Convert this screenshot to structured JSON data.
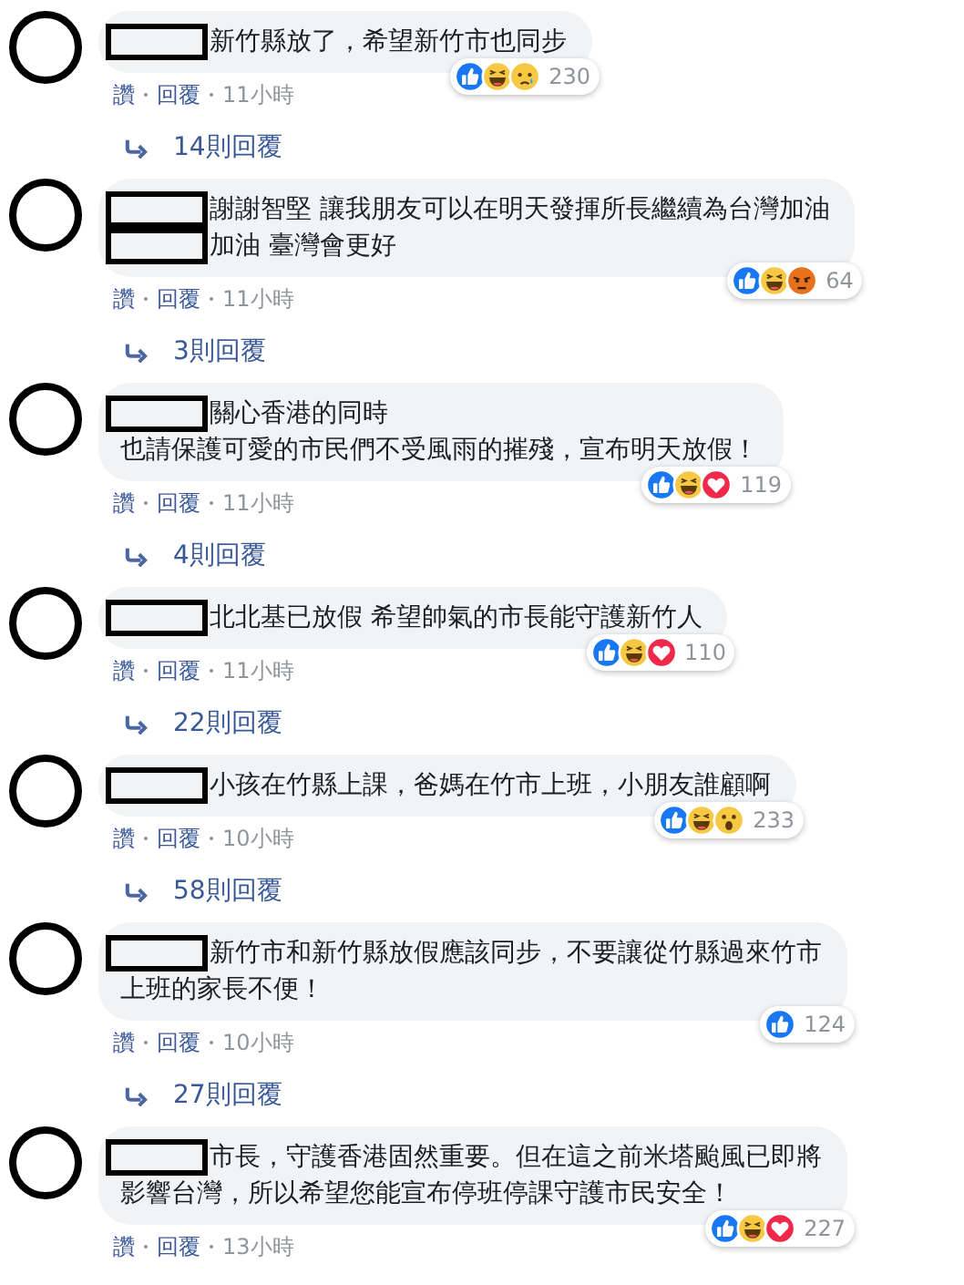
{
  "comments": [
    {
      "lines": [
        {
          "redacted": true,
          "text": "新竹縣放了，希望新竹市也同步"
        }
      ],
      "reactions": [
        {
          "kind": "like"
        },
        {
          "kind": "haha"
        },
        {
          "kind": "sad"
        }
      ],
      "reaction_count": "230",
      "like_label": "讚",
      "reply_label": "回覆",
      "time": "11小時",
      "replies": "14則回覆"
    },
    {
      "lines": [
        {
          "redacted": true,
          "text": "謝謝智堅 讓我朋友可以在明天發揮所長繼續為台灣加油"
        },
        {
          "redacted": true,
          "text": "加油 臺灣會更好"
        }
      ],
      "reactions": [
        {
          "kind": "like"
        },
        {
          "kind": "haha"
        },
        {
          "kind": "angry"
        }
      ],
      "reaction_count": "64",
      "like_label": "讚",
      "reply_label": "回覆",
      "time": "11小時",
      "replies": "3則回覆"
    },
    {
      "lines": [
        {
          "redacted": true,
          "text": "關心香港的同時"
        },
        {
          "redacted": false,
          "text": "也請保護可愛的市民們不受風雨的摧殘，宣布明天放假！"
        }
      ],
      "reactions": [
        {
          "kind": "like"
        },
        {
          "kind": "haha"
        },
        {
          "kind": "love"
        }
      ],
      "reaction_count": "119",
      "like_label": "讚",
      "reply_label": "回覆",
      "time": "11小時",
      "replies": "4則回覆"
    },
    {
      "lines": [
        {
          "redacted": true,
          "text": "北北基已放假 希望帥氣的市長能守護新竹人"
        }
      ],
      "reactions": [
        {
          "kind": "like"
        },
        {
          "kind": "haha"
        },
        {
          "kind": "love"
        }
      ],
      "reaction_count": "110",
      "like_label": "讚",
      "reply_label": "回覆",
      "time": "11小時",
      "replies": "22則回覆"
    },
    {
      "lines": [
        {
          "redacted": true,
          "text": "小孩在竹縣上課，爸媽在竹市上班，小朋友誰顧啊"
        }
      ],
      "reactions": [
        {
          "kind": "like"
        },
        {
          "kind": "haha"
        },
        {
          "kind": "wow"
        }
      ],
      "reaction_count": "233",
      "like_label": "讚",
      "reply_label": "回覆",
      "time": "10小時",
      "replies": "58則回覆"
    },
    {
      "lines": [
        {
          "redacted": true,
          "text": "新竹市和新竹縣放假應該同步，不要讓從竹縣過來竹市"
        },
        {
          "redacted": false,
          "text": "上班的家長不便！"
        }
      ],
      "reactions": [
        {
          "kind": "like"
        }
      ],
      "reaction_count": "124",
      "like_label": "讚",
      "reply_label": "回覆",
      "time": "10小時",
      "replies": "27則回覆"
    },
    {
      "lines": [
        {
          "redacted": true,
          "text": "市長，守護香港固然重要。但在這之前米塔颱風已即將"
        },
        {
          "redacted": false,
          "text": "影響台灣，所以希望您能宣布停班停課守護市民安全！"
        }
      ],
      "reactions": [
        {
          "kind": "like"
        },
        {
          "kind": "haha"
        },
        {
          "kind": "love"
        }
      ],
      "reaction_count": "227",
      "like_label": "讚",
      "reply_label": "回覆",
      "time": "13小時"
    }
  ]
}
